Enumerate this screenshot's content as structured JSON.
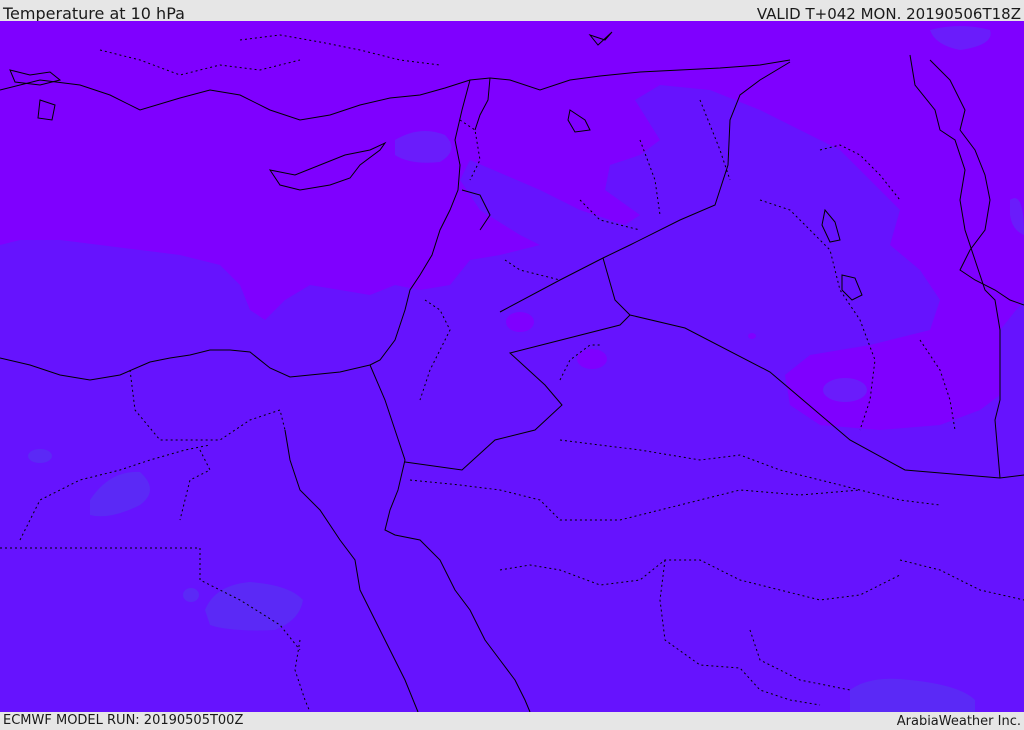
{
  "header": {
    "title": "Temperature at 10 hPa",
    "valid_time": "VALID T+042 MON. 20190506T18Z"
  },
  "footer": {
    "model_run": "ECMWF MODEL RUN: 20190505T00Z",
    "credit": "ArabiaWeather Inc."
  },
  "colors": {
    "field_warm": "#7f00ff",
    "field_main": "#6613fe",
    "field_patch": "#5a2af5",
    "bar_background": "#e6e6e6",
    "coastline": "#000000"
  },
  "icons": [
    "map-canvas"
  ]
}
